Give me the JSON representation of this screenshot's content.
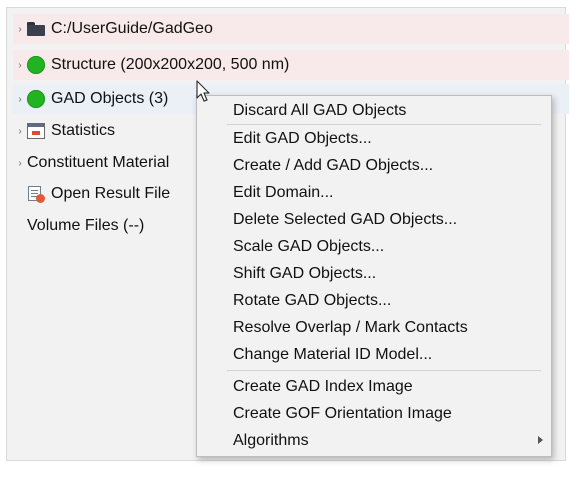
{
  "tree": {
    "items": [
      {
        "label": "C:/UserGuide/GadGeo",
        "icon": "folder-icon"
      },
      {
        "label": "Structure (200x200x200, 500 nm)",
        "icon": "green-status-icon"
      },
      {
        "label": "GAD Objects (3)",
        "icon": "green-status-icon"
      },
      {
        "label": "Statistics",
        "icon": "statistics-icon"
      },
      {
        "label": "Constituent Material",
        "icon": null
      },
      {
        "label": "Open Result File",
        "icon": "result-file-icon"
      },
      {
        "label": "Volume Files (--)",
        "icon": null
      }
    ]
  },
  "context_menu": {
    "items": [
      {
        "label": "Discard All GAD Objects"
      },
      {
        "label": "Edit GAD Objects..."
      },
      {
        "label": "Create / Add GAD Objects..."
      },
      {
        "label": "Edit Domain..."
      },
      {
        "label": "Delete Selected GAD Objects..."
      },
      {
        "label": "Scale GAD Objects..."
      },
      {
        "label": "Shift GAD Objects..."
      },
      {
        "label": "Rotate GAD Objects..."
      },
      {
        "label": "Resolve Overlap / Mark Contacts"
      },
      {
        "label": "Change Material ID Model..."
      },
      {
        "label": "Create GAD Index Image"
      },
      {
        "label": "Create GOF Orientation Image"
      },
      {
        "label": "Algorithms",
        "submenu": true
      }
    ]
  },
  "colors": {
    "status_green": "#22b322",
    "row_highlight": "#f8e9ea",
    "row_selected": "#ebeff6",
    "menu_background": "#f2f2f2"
  }
}
